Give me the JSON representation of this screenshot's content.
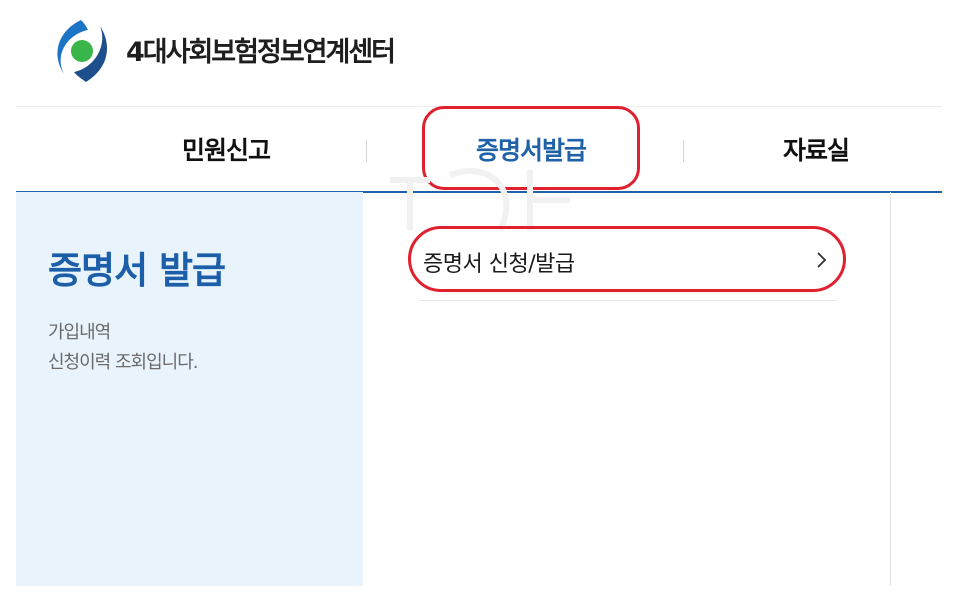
{
  "header": {
    "site_name": "4대사회보험정보연계센터",
    "logo_icon": "four-social-insurance-logo-icon",
    "colors": {
      "logo_blue": "#1b74c5",
      "logo_green": "#39b54a",
      "logo_navy": "#1c4f8c"
    }
  },
  "gnb": {
    "items": [
      {
        "label": "민원신고",
        "active": false
      },
      {
        "label": "증명서발급",
        "active": true
      },
      {
        "label": "자료실",
        "active": false
      }
    ],
    "active_color": "#1f62a8",
    "underline_color": "#1f62a8"
  },
  "lnb": {
    "title": "증명서 발급",
    "description_lines": [
      "가입내역",
      "신청이력 조회입니다."
    ],
    "background": "#e8f3fc"
  },
  "content": {
    "submenu": [
      {
        "label": "증명서 신청/발급",
        "icon": "chevron-right-icon"
      }
    ]
  },
  "annotations": {
    "highlight_color": "#e0202e"
  }
}
